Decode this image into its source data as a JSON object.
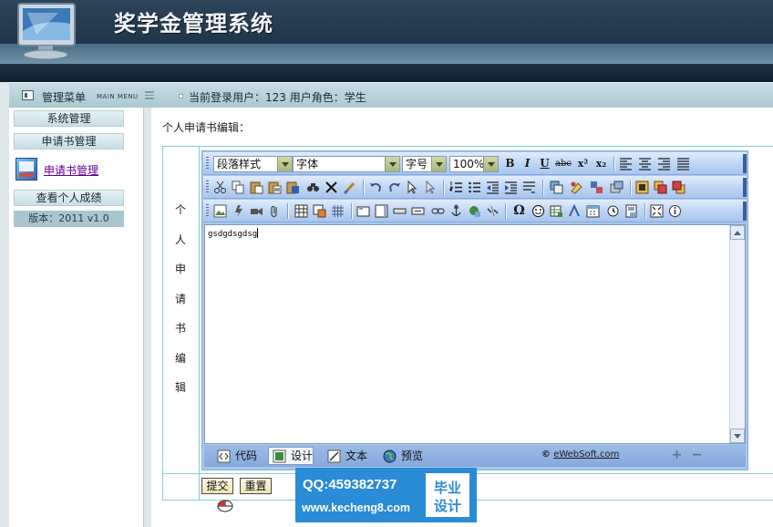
{
  "header": {
    "title": "奖学金管理系统"
  },
  "navbar": {
    "menu_title": "管理菜单",
    "menu_sub": "MAIN MENU",
    "user_info": "当前登录用户：123   用户角色：学生"
  },
  "sidebar": {
    "system_mgmt": "系统管理",
    "application_mgmt": "申请书管理",
    "application_link": "申请书管理",
    "view_scores": "查看个人成绩",
    "version": "版本：2011 v1.0"
  },
  "main": {
    "label": "个人申请书编辑：",
    "vertical_label": [
      "个",
      "人",
      "申",
      "请",
      "书",
      "编",
      "辑"
    ]
  },
  "editor": {
    "paragraph_style": "段落样式",
    "font_family": "字体",
    "font_size": "字号",
    "zoom": "100%",
    "content": "gsdgdsgdsg",
    "tabs": {
      "code": "代码",
      "design": "设计",
      "text": "文本",
      "preview": "预览"
    },
    "brand_prefix": "©",
    "brand": "eWebSoft.com",
    "bold_glyph": "B",
    "italic_glyph": "I",
    "underline_glyph": "U",
    "strike_glyph": "abc",
    "sup_glyph": "x²",
    "sub_glyph": "x₂"
  },
  "form": {
    "submit": "提交",
    "reset": "重置"
  },
  "watermark": {
    "qq": "QQ:459382737",
    "url": "www.kecheng8.com",
    "badge_line1": "毕业",
    "badge_line2": "设计"
  },
  "colors": {
    "header_bg": "#20364b",
    "navbar_bg": "#aac8d1",
    "editor_bg": "#a9c8ec",
    "frame_line": "#7fcfd8",
    "watermark_bg": "#2a8bd6"
  }
}
